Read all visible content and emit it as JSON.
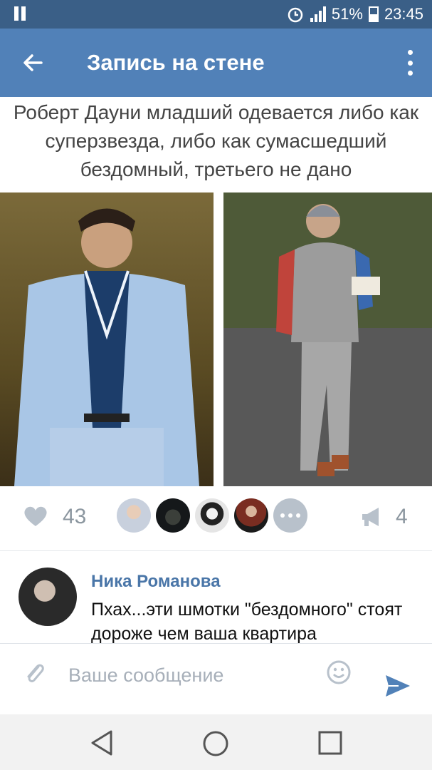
{
  "status_bar": {
    "battery_percent": "51%",
    "time": "23:45",
    "icons": [
      "pause-icon",
      "alarm-icon",
      "signal-icon",
      "battery-icon"
    ]
  },
  "app_bar": {
    "title": "Запись на стене",
    "back_icon": "back-arrow-icon",
    "menu_icon": "more-vertical-icon"
  },
  "post": {
    "caption": "Роберт Дауни младший одевается либо как суперзвезда, либо как сумасшедший бездомный, третьего не дано",
    "images": [
      "photo-suit",
      "photo-casual"
    ]
  },
  "reactions": {
    "likes_count": "43",
    "reposts_count": "4",
    "liker_avatar_count": 4,
    "more_icon": "ellipsis-icon"
  },
  "comment": {
    "author": "Ника Романова",
    "text": "Пхах...эти шмотки \"бездомного\" стоят дороже чем ваша квартира"
  },
  "composer": {
    "placeholder": "Ваше сообщение",
    "value": "",
    "icons": [
      "paperclip-icon",
      "emoji-icon",
      "send-icon"
    ]
  },
  "nav_bar": {
    "icons": [
      "back-triangle-icon",
      "home-circle-icon",
      "recent-square-icon"
    ]
  },
  "colors": {
    "status_bar": "#3a5f87",
    "app_bar": "#5181b8",
    "accent_link": "#4a76a8",
    "counter_text": "#8b969f"
  }
}
